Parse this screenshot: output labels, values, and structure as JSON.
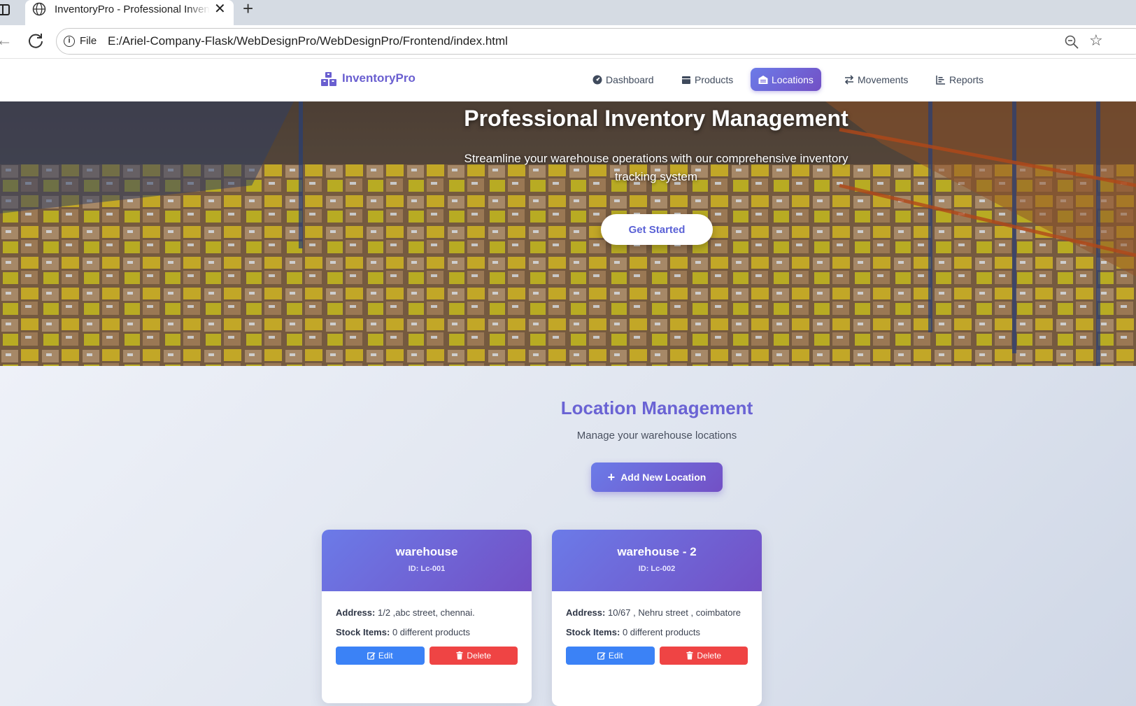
{
  "browser": {
    "tab_title": "InventoryPro - Professional Inventory Management",
    "file_label": "File",
    "url": "E:/Ariel-Company-Flask/WebDesignPro/WebDesignPro/Frontend/index.html"
  },
  "header": {
    "brand": "InventoryPro",
    "nav": [
      {
        "label": "Dashboard",
        "icon": "dashboard-icon",
        "active": false
      },
      {
        "label": "Products",
        "icon": "box-icon",
        "active": false
      },
      {
        "label": "Locations",
        "icon": "warehouse-icon",
        "active": true
      },
      {
        "label": "Movements",
        "icon": "exchange-icon",
        "active": false
      },
      {
        "label": "Reports",
        "icon": "chart-icon",
        "active": false
      }
    ]
  },
  "hero": {
    "title": "Professional Inventory Management",
    "subtitle": "Streamline your warehouse operations with our comprehensive inventory tracking system",
    "cta": "Get Started"
  },
  "section": {
    "title": "Location Management",
    "subtitle": "Manage your warehouse locations",
    "add_button": "Add New Location"
  },
  "labels": {
    "address": "Address:",
    "stock_items": "Stock Items:",
    "edit": "Edit",
    "delete": "Delete"
  },
  "locations": [
    {
      "name": "warehouse",
      "id": "ID: Lc-001",
      "address": "1/2 ,abc street, chennai.",
      "stock": "0 different products"
    },
    {
      "name": "warehouse - 2",
      "id": "ID: Lc-002",
      "address": "10/67 , Nehru street , coimbatore",
      "stock": "0 different products"
    }
  ],
  "colors": {
    "accent_start": "#6b7be8",
    "accent_end": "#7350c5",
    "edit": "#3b82f6",
    "delete": "#ef4444",
    "title": "#6a63d4"
  }
}
